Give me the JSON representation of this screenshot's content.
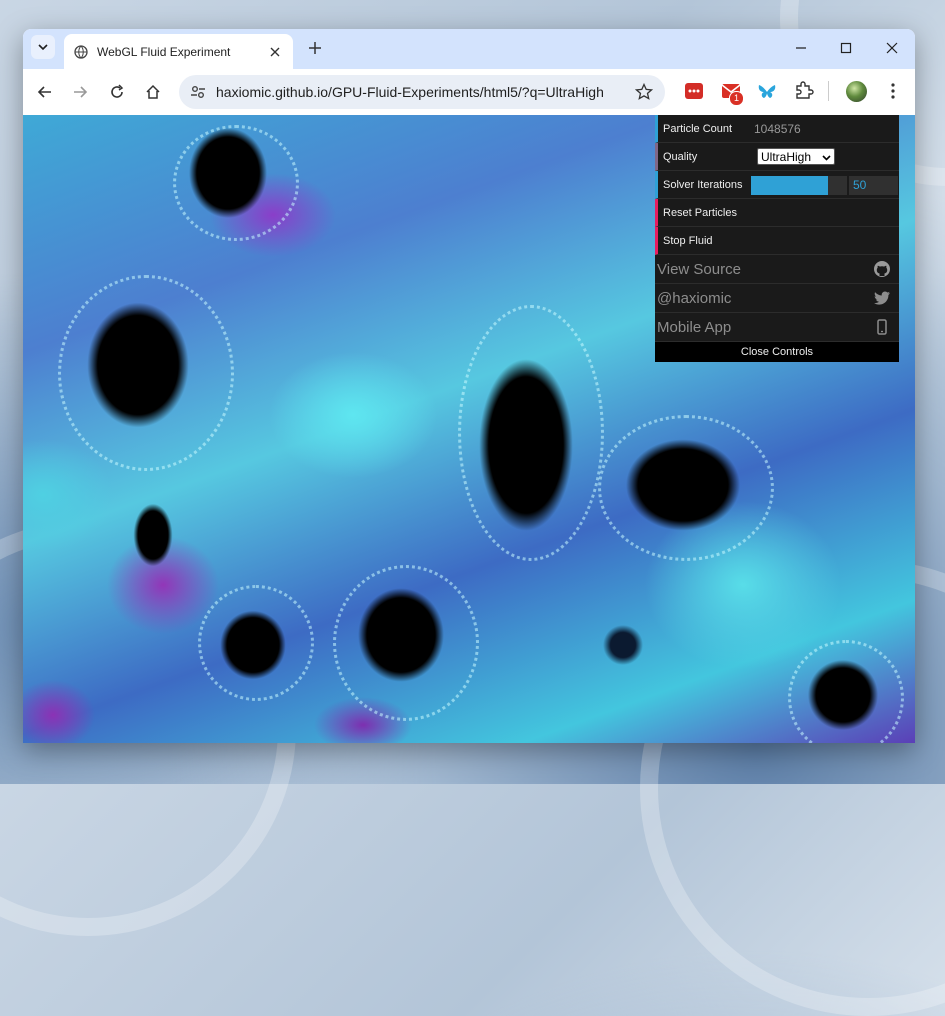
{
  "browser": {
    "tab_title": "WebGL Fluid Experiment",
    "url": "haxiomic.github.io/GPU-Fluid-Experiments/html5/?q=UltraHigh",
    "notification_badge": "1"
  },
  "controls": {
    "particle_count": {
      "label": "Particle Count",
      "value": "1048576"
    },
    "quality": {
      "label": "Quality",
      "selected": "UltraHigh"
    },
    "solver_iterations": {
      "label": "Solver Iterations",
      "value": "50",
      "fill_fraction": 0.8
    },
    "reset_particles": {
      "label": "Reset Particles"
    },
    "stop_fluid": {
      "label": "Stop Fluid"
    },
    "view_source": {
      "label": "View Source",
      "icon": "github-icon"
    },
    "twitter": {
      "label": "@haxiomic",
      "icon": "twitter-icon"
    },
    "mobile_app": {
      "label": "Mobile App",
      "icon": "mobile-icon"
    },
    "close_controls": "Close Controls"
  },
  "colors": {
    "number_accent": "#2fa1d6",
    "option_accent": "#806787",
    "function_accent": "#e61d5f"
  }
}
